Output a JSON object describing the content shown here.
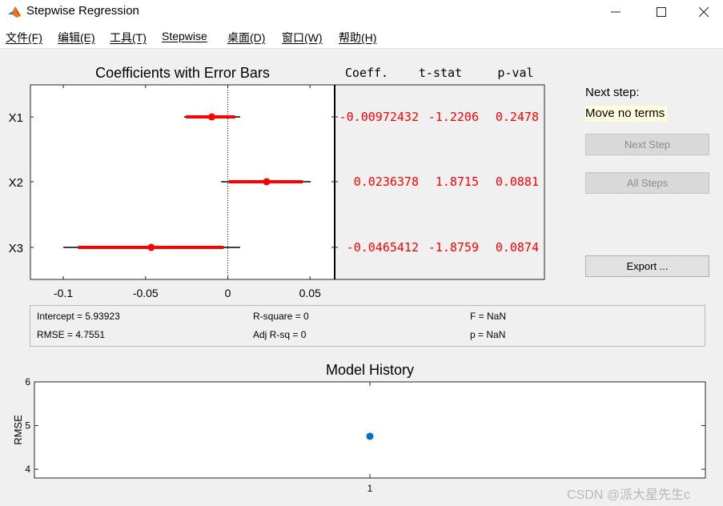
{
  "window": {
    "title": "Stepwise Regression"
  },
  "menu": [
    {
      "label": "文件(F)"
    },
    {
      "label": "编辑(E)"
    },
    {
      "label": "工具(T)"
    },
    {
      "label": "Stepwise"
    },
    {
      "label": "桌面(D)"
    },
    {
      "label": "窗口(W)"
    },
    {
      "label": "帮助(H)"
    }
  ],
  "coef_plot": {
    "title": "Coefficients with Error Bars",
    "xlim": [
      -0.12,
      0.065
    ],
    "x_ticks": [
      "-0.1",
      "-0.05",
      "0",
      "0.05"
    ],
    "x_tick_values": [
      -0.1,
      -0.05,
      0,
      0.05
    ],
    "rows": [
      {
        "label": "X1",
        "coef": -0.00972432,
        "ci68": [
          -0.0255,
          0.0045
        ],
        "ci95": [
          -0.0265,
          0.0075
        ]
      },
      {
        "label": "X2",
        "coef": 0.0236378,
        "ci68": [
          0.0005,
          0.0455
        ],
        "ci95": [
          -0.004,
          0.0505
        ]
      },
      {
        "label": "X3",
        "coef": -0.0465412,
        "ci68": [
          -0.091,
          -0.0025
        ],
        "ci95": [
          -0.1,
          0.0075
        ]
      }
    ],
    "bar_color": "#ff0000"
  },
  "coef_table": {
    "headers": {
      "coeff": "Coeff.",
      "tstat": "t-stat",
      "pval": "p-val"
    },
    "rows": [
      {
        "coeff": "-0.00972432",
        "tstat": "-1.2206",
        "pval": "0.2478"
      },
      {
        "coeff": "0.0236378",
        "tstat": "1.8715",
        "pval": "0.0881"
      },
      {
        "coeff": "-0.0465412",
        "tstat": "-1.8759",
        "pval": "0.0874"
      }
    ],
    "text_color": "#ff0000"
  },
  "stats": {
    "intercept": "Intercept = 5.93923",
    "rmse": "RMSE = 4.7551",
    "rsq": "R-square = 0",
    "adj_rsq": "Adj R-sq = 0",
    "f": "F = NaN",
    "p": "p = NaN"
  },
  "side": {
    "next_step_label": "Next step:",
    "next_step_value": "Move no terms",
    "next_step_button": "Next Step",
    "all_steps_button": "All Steps",
    "export_button": "Export ..."
  },
  "chart_data": {
    "type": "scatter",
    "title": "Model History",
    "xlabel": "",
    "ylabel": "RMSE",
    "x_ticks": [
      "1"
    ],
    "y_ticks": [
      "4",
      "5",
      "6"
    ],
    "ylim": [
      3.8,
      6
    ],
    "xlim": [
      0,
      2
    ],
    "points": [
      {
        "x": 1,
        "y": 4.7551
      }
    ],
    "color": "#0072bd"
  },
  "watermark": "CSDN @派大星先生c"
}
